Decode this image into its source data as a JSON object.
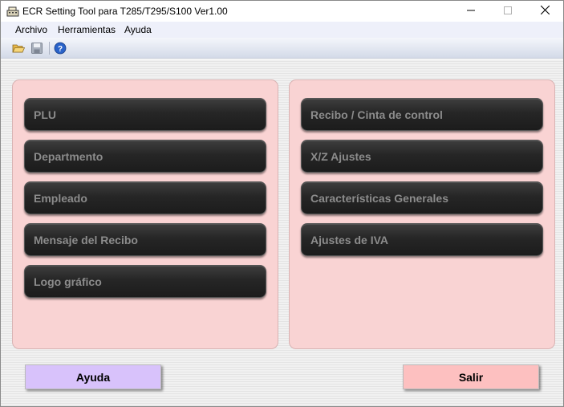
{
  "window": {
    "title": "ECR Setting Tool para T285/T295/S100 Ver1.00"
  },
  "menu": {
    "items": [
      "Archivo",
      "Herramientas",
      "Ayuda"
    ]
  },
  "toolbar": {
    "icons": [
      "open-folder-icon",
      "save-icon",
      "help-icon"
    ]
  },
  "left_panel": {
    "buttons": [
      "PLU",
      "Departmento",
      "Empleado",
      "Mensaje del Recibo",
      "Logo gráfico"
    ]
  },
  "right_panel": {
    "buttons": [
      "Recibo / Cinta de control",
      "X/Z Ajustes",
      "Características Generales",
      "Ajustes de IVA"
    ]
  },
  "footer": {
    "help_label": "Ayuda",
    "exit_label": "Salir"
  },
  "colors": {
    "panel_bg": "#f9d3d3",
    "function_button_bg": "#262626",
    "function_button_text": "#8c8c8c",
    "help_button_bg": "#d8c2fb",
    "exit_button_bg": "#fdc0c0"
  }
}
